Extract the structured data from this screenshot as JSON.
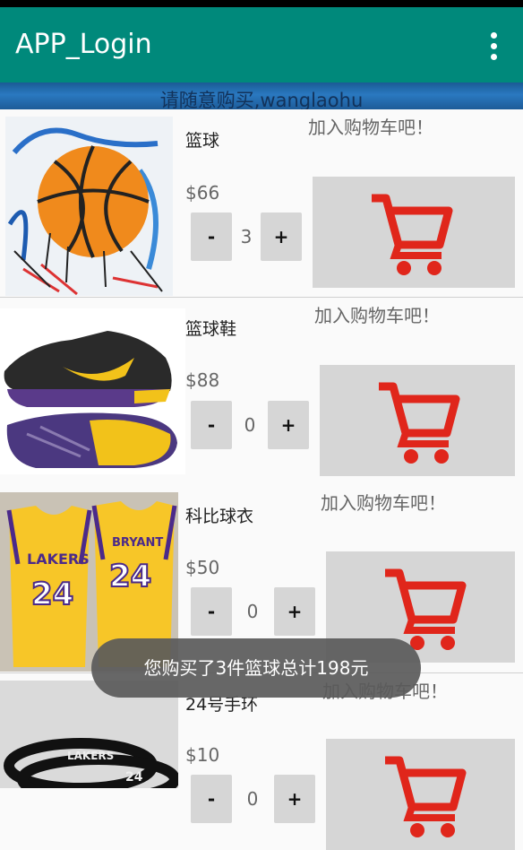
{
  "app": {
    "title": "APP_Login"
  },
  "banner": {
    "text": "请随意购买,wanglaohu"
  },
  "products": [
    {
      "name": "篮球",
      "price": "$66",
      "quantity": "3",
      "minus": "-",
      "plus": "+",
      "hint": "加入购物车吧！",
      "image": "basketball-painting"
    },
    {
      "name": "篮球鞋",
      "price": "$88",
      "quantity": "0",
      "minus": "-",
      "plus": "+",
      "hint": "加入购物车吧！",
      "image": "basketball-shoes"
    },
    {
      "name": "科比球衣",
      "price": "$50",
      "quantity": "0",
      "minus": "-",
      "plus": "+",
      "hint": "加入购物车吧！",
      "image": "kobe-jersey"
    },
    {
      "name": "24号手环",
      "price": "$10",
      "quantity": "0",
      "minus": "-",
      "plus": "+",
      "hint": "加入购物车吧！",
      "image": "wristbands"
    }
  ],
  "toast": {
    "text": "您购买了3件篮球总计198元"
  },
  "colors": {
    "appbar": "#00897b",
    "cart": "#e0261b",
    "button": "#d6d6d6"
  }
}
